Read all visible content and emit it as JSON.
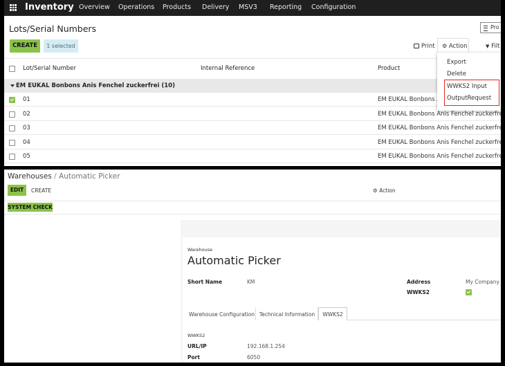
{
  "navbar": {
    "brand": "Inventory",
    "items": [
      "Overview",
      "Operations",
      "Products",
      "Delivery",
      "MSV3",
      "Reporting",
      "Configuration"
    ]
  },
  "lots": {
    "title": "Lots/Serial Numbers",
    "search_fragment": "Pro",
    "create_label": "CREATE",
    "selected_label": "1 selected",
    "print_label": "Print",
    "action_label": "Action",
    "filter_fragment": "Filt",
    "columns": [
      "Lot/Serial Number",
      "Internal Reference",
      "Product"
    ],
    "group_label": "EM EUKAL Bonbons Anis Fenchel zuckerfrei (10)",
    "rows": [
      {
        "lot": "01",
        "product": "EM EUKAL Bonbons A",
        "checked": true
      },
      {
        "lot": "02",
        "product": "EM EUKAL Bonbons Anis Fenchel zuckerfrei",
        "checked": false
      },
      {
        "lot": "03",
        "product": "EM EUKAL Bonbons Anis Fenchel zuckerfrei",
        "checked": false
      },
      {
        "lot": "04",
        "product": "EM EUKAL Bonbons Anis Fenchel zuckerfrei",
        "checked": false
      },
      {
        "lot": "05",
        "product": "EM EUKAL Bonbons Anis Fenchel zuckerfrei",
        "checked": false
      }
    ],
    "action_menu": [
      "Export",
      "Delete",
      "WWKS2 Input",
      "OutputRequest"
    ],
    "highlight_color": "#e0261f",
    "accent_color": "#8bc34a"
  },
  "warehouse": {
    "breadcrumb_parent": "Warehouses",
    "breadcrumb_sep": " / ",
    "breadcrumb_current": "Automatic Picker",
    "edit_label": "EDIT",
    "create_label": "CREATE",
    "action_label": "Action",
    "system_check_label": "SYSTEM CHECK",
    "form_label": "Warehouse",
    "name": "Automatic Picker",
    "short_name_label": "Short Name",
    "short_name_value": "KM",
    "address_label": "Address",
    "address_value": "My Company",
    "wwks2_label": "WWKS2",
    "wwks2_checked": true,
    "tabs": [
      "Warehouse Configuration",
      "Technical Information",
      "WWKS2"
    ],
    "section_label": "WWKS2",
    "url_label": "URL/IP",
    "url_value": "192.168.1.254",
    "port_label": "Port",
    "port_value": "6050"
  }
}
